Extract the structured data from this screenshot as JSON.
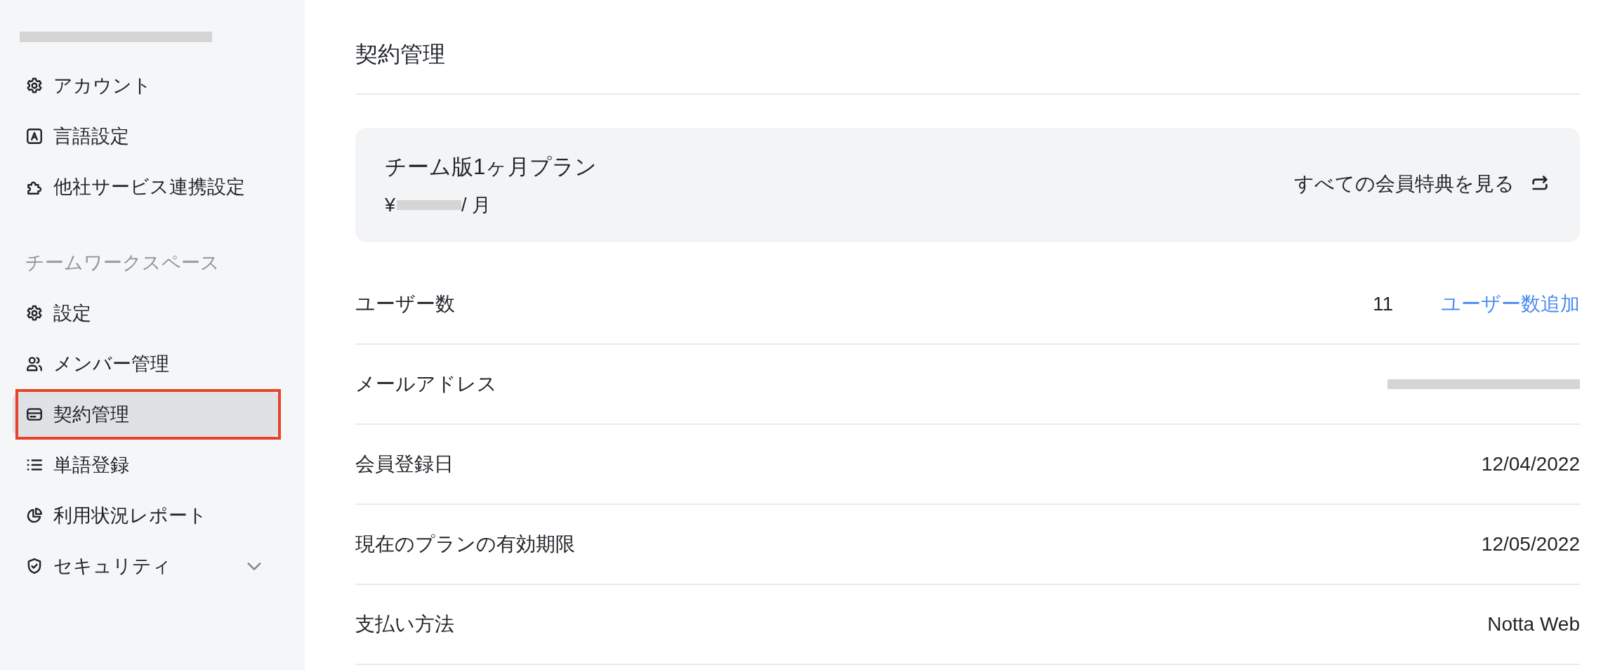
{
  "sidebar": {
    "account": {
      "email_redacted": true
    },
    "sections": [
      {
        "items": [
          {
            "label": "アカウント",
            "selected": false,
            "outlined": false
          },
          {
            "label": "言語設定",
            "selected": false,
            "outlined": false
          },
          {
            "label": "他社サービス連携設定",
            "selected": false,
            "outlined": false
          }
        ]
      },
      {
        "heading": "チームワークスペース",
        "items": [
          {
            "label": "設定",
            "selected": false,
            "outlined": false
          },
          {
            "label": "メンバー管理",
            "selected": false,
            "outlined": false
          },
          {
            "label": "契約管理",
            "selected": true,
            "outlined": true
          },
          {
            "label": "単語登録",
            "selected": false,
            "outlined": false
          },
          {
            "label": "利用状況レポート",
            "selected": false,
            "outlined": false
          },
          {
            "label": "セキュリティ",
            "selected": false,
            "outlined": false,
            "expanded": false
          }
        ]
      }
    ]
  },
  "main": {
    "title": "契約管理",
    "plan": {
      "name": "チーム版1ヶ月プラン",
      "price_currency": "¥",
      "price_redacted": true,
      "price_unit": "/ 月",
      "benefits_link": "すべての会員特典を見る"
    },
    "rows": [
      {
        "label": "ユーザー数",
        "value": "11",
        "action": "ユーザー数追加"
      },
      {
        "label": "メールアドレス",
        "value_redacted": true
      },
      {
        "label": "会員登録日",
        "value": "12/04/2022"
      },
      {
        "label": "現在のプランの有効期限",
        "value": "12/05/2022"
      },
      {
        "label": "支払い方法",
        "value": "Notta Web"
      }
    ]
  }
}
